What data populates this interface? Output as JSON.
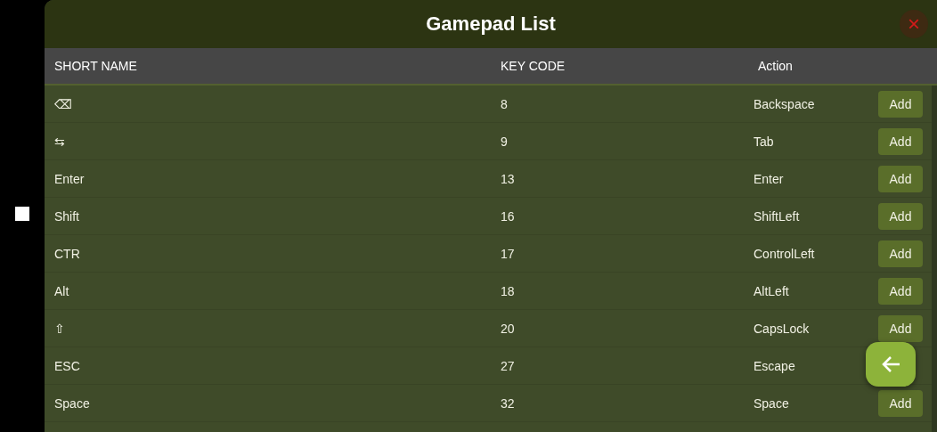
{
  "dialog": {
    "title": "Gamepad List",
    "close_icon": "×"
  },
  "table": {
    "columns": [
      "SHORT NAME",
      "KEY CODE",
      "Action"
    ],
    "rows": [
      {
        "short_name": "⌫",
        "key_code": "8",
        "action": "Backspace",
        "button": "Add"
      },
      {
        "short_name": "⇆",
        "key_code": "9",
        "action": "Tab",
        "button": "Add"
      },
      {
        "short_name": "Enter",
        "key_code": "13",
        "action": "Enter",
        "button": "Add"
      },
      {
        "short_name": "Shift",
        "key_code": "16",
        "action": "ShiftLeft",
        "button": "Add"
      },
      {
        "short_name": "CTR",
        "key_code": "17",
        "action": "ControlLeft",
        "button": "Add"
      },
      {
        "short_name": "Alt",
        "key_code": "18",
        "action": "AltLeft",
        "button": "Add"
      },
      {
        "short_name": "⇧",
        "key_code": "20",
        "action": "CapsLock",
        "button": "Add"
      },
      {
        "short_name": "ESC",
        "key_code": "27",
        "action": "Escape"
      },
      {
        "short_name": "Space",
        "key_code": "32",
        "action": "Space",
        "button": "Add"
      }
    ]
  }
}
